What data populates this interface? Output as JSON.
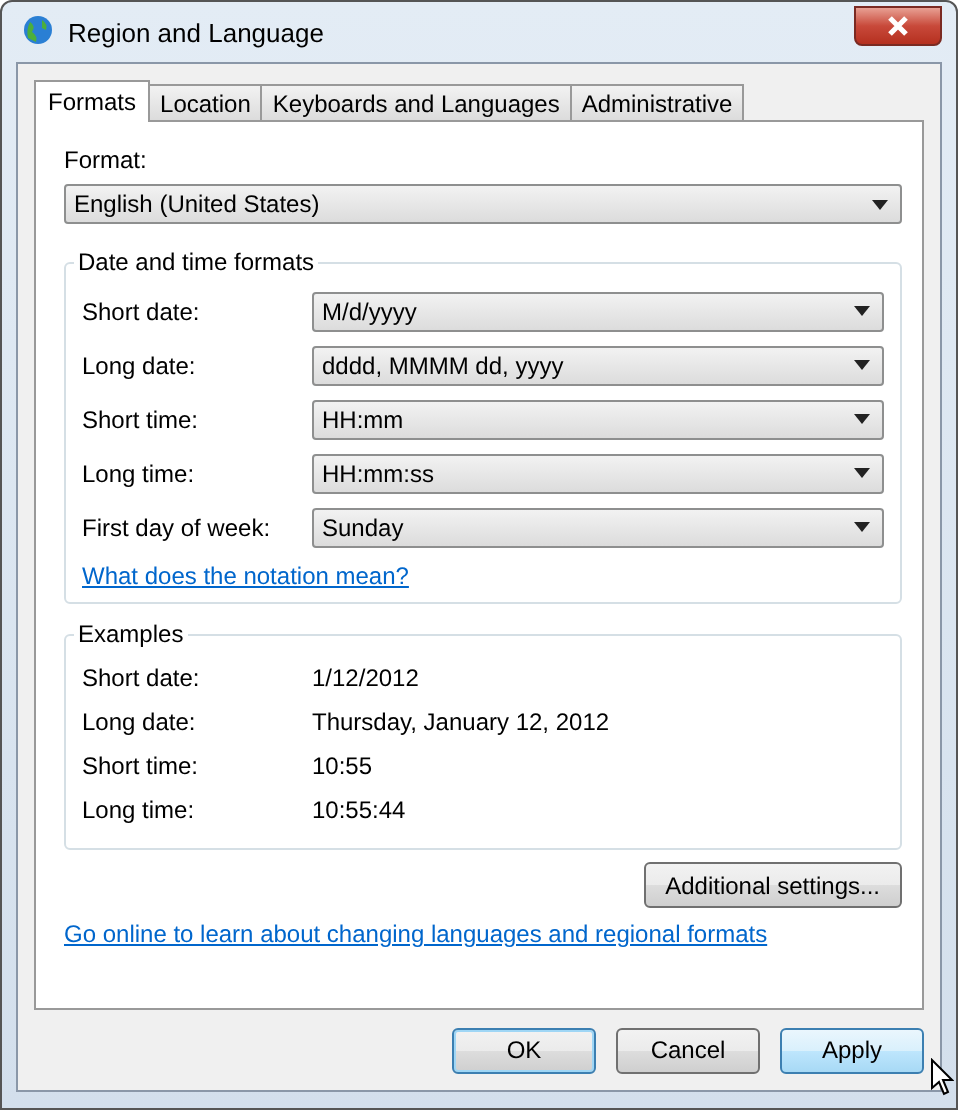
{
  "window": {
    "title": "Region and Language"
  },
  "tabs": [
    {
      "label": "Formats",
      "selected": true
    },
    {
      "label": "Location",
      "selected": false
    },
    {
      "label": "Keyboards and Languages",
      "selected": false
    },
    {
      "label": "Administrative",
      "selected": false
    }
  ],
  "format": {
    "label": "Format:",
    "value": "English (United States)"
  },
  "date_time_formats": {
    "title": "Date and time formats",
    "rows": [
      {
        "label": "Short date:",
        "value": "M/d/yyyy"
      },
      {
        "label": "Long date:",
        "value": "dddd, MMMM dd, yyyy"
      },
      {
        "label": "Short time:",
        "value": "HH:mm"
      },
      {
        "label": "Long time:",
        "value": "HH:mm:ss"
      },
      {
        "label": "First day of week:",
        "value": "Sunday"
      }
    ],
    "link": "What does the notation mean?"
  },
  "examples": {
    "title": "Examples",
    "rows": [
      {
        "label": "Short date:",
        "value": "1/12/2012"
      },
      {
        "label": "Long date:",
        "value": "Thursday, January 12, 2012"
      },
      {
        "label": "Short time:",
        "value": "10:55"
      },
      {
        "label": "Long time:",
        "value": "10:55:44"
      }
    ]
  },
  "additional_button": "Additional settings...",
  "online_link": "Go online to learn about changing languages and regional formats",
  "buttons": [
    {
      "label": "OK",
      "default": true,
      "hovered": false
    },
    {
      "label": "Cancel",
      "default": false,
      "hovered": false
    },
    {
      "label": "Apply",
      "default": false,
      "hovered": true
    }
  ]
}
